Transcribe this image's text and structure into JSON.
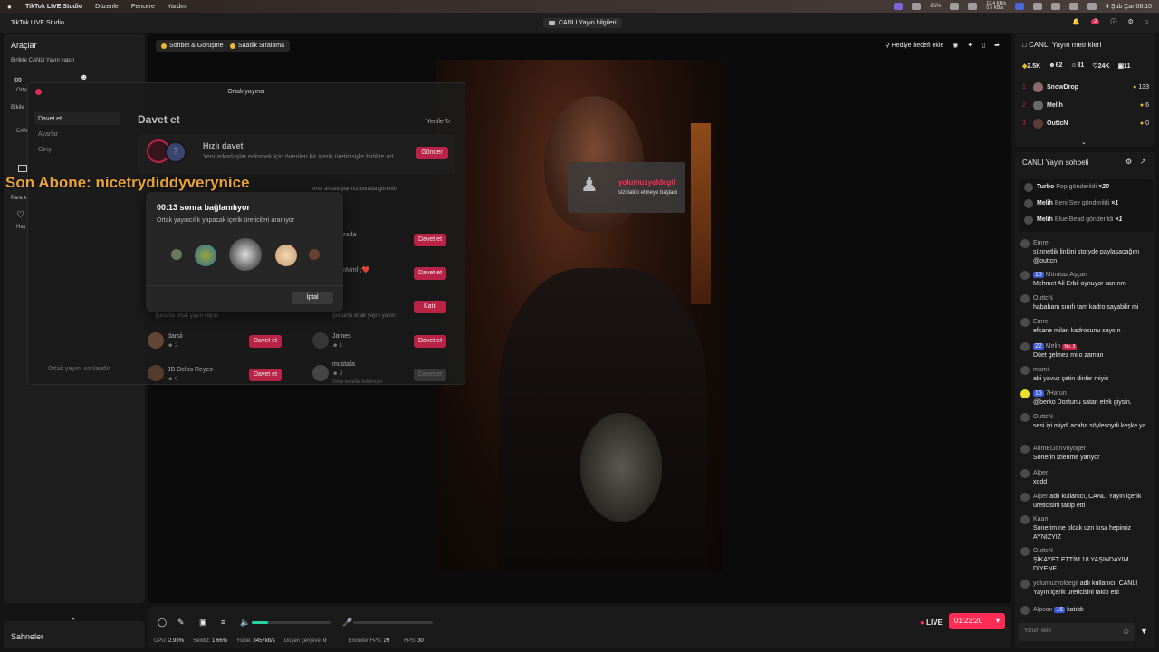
{
  "menubar": {
    "app": "TikTok LIVE Studio",
    "items": [
      "Düzenle",
      "Pencere",
      "Yardım"
    ],
    "datetime": "4 Şub Çar  06:10",
    "battery": "86%",
    "net_up": "12.4 KB/s",
    "net_down": "0.6 KB/s"
  },
  "titlebar": {
    "title": "TikTok LIVE Studio",
    "center": "CANLI Yayın bilgileri",
    "badge": "2"
  },
  "left": {
    "title": "Araçlar",
    "section1": "Birlikte CANLI Yayın yapın",
    "tool1": "Orta",
    "section2": "Etkile",
    "tool2": "CAN",
    "section3": "Para k",
    "tool3": "Hay",
    "scenes": "Sahneler"
  },
  "center": {
    "pill1": "Sohbet & Görüşme",
    "pill2": "Saatlik Sıralama",
    "gift_goal": "Hediye hedefi ekle"
  },
  "follow_popup": {
    "user": "yolumuzyoldegil",
    "text": "sizi takip etmeye başladı"
  },
  "overlay_text": "Son Abone: nicetrydiddyverynice",
  "modal": {
    "title": "Ortak yayıncı",
    "nav": [
      "Davet et",
      "Ayarlar",
      "Giriş"
    ],
    "heading": "Davet et",
    "refresh": "Yenile",
    "quick_title": "Hızlı davet",
    "quick_desc": "Yeni arkadaşlar edinmek için önerilen bir içerik üreticisiyle birlikte ort...",
    "send_btn": "Gönder",
    "info_text": "rımcı arkadaşlarınız burada görünür",
    "rows": [
      {
        "name": "nie Quizada",
        "btn": "Davet et"
      },
      {
        "name": "ile KimMml);❤️",
        "btn": "Davet et"
      },
      {
        "name": "e",
        "btn": "Katıl"
      }
    ],
    "row3_sub": "Şununla ortak yayın yapın:",
    "row3_sub2": "Şununla ortak yayın yapın:",
    "grid": [
      {
        "name": "darsii",
        "count": "2",
        "btn": "Davet et"
      },
      {
        "name": "James",
        "count": "1",
        "btn": "Davet et"
      },
      {
        "name": "JB Delos Reyes",
        "count": "0",
        "btn": "Davet et"
      },
      {
        "name": "mustafa",
        "count": "2",
        "btn": "Davet et",
        "sub": "Ortak kanallar bekleniyor"
      }
    ],
    "bottom_left": "Ortak yayını sonlandır"
  },
  "connecting": {
    "title": "00:13 sonra bağlanılıyor",
    "subtitle": "Ortak yayıncılık yapacak içerik üreticileri aranıyor",
    "cancel": "İptal"
  },
  "metrics": {
    "title": "CANLI Yayın metrikleri",
    "stats": [
      "2.5K",
      "62",
      "31",
      "24K",
      "11"
    ],
    "rank": [
      {
        "name": "SnowDrop",
        "value": "133"
      },
      {
        "name": "Melih",
        "value": "6"
      },
      {
        "name": "OuttcN",
        "value": "0"
      }
    ]
  },
  "chat": {
    "title": "CANLI Yayın sohbeti",
    "gifts": [
      {
        "user": "Turbo",
        "text": "Pop gönderildi",
        "mult": "×20"
      },
      {
        "user": "Melih",
        "text": "Beni Sev gönderildi",
        "mult": "×1"
      },
      {
        "user": "Melih",
        "text": "Blue Bead gönderildi",
        "mult": "×1"
      }
    ],
    "messages": [
      {
        "user": "Emre",
        "text": "sünnetlik linkini storyde paylaşacağım @outtcn"
      },
      {
        "user": "Mümtaz Aşçan",
        "badge": "10",
        "text": "Mehmet Ali Erbil oynuyor sanırım"
      },
      {
        "user": "OuttcN",
        "text": "hababam sınıfı tam kadro sayabilir mi"
      },
      {
        "user": "Emre",
        "text": "efsane milan kadrosunu saysın"
      },
      {
        "user": "Melih",
        "badge": "22",
        "rank": "No. 3",
        "text": "Düet gelmez mi o zaman"
      },
      {
        "user": "mami",
        "text": "abi yavuz çetin dinler miyiz"
      },
      {
        "user": "7Harun",
        "badge": "16",
        "text": "@berko Dostunu satan etek giysin."
      },
      {
        "user": "OuttcN",
        "text": "sesi iyi miydi acaba söylesoydi keşke ya"
      },
      {
        "user": "AhmEtJönVoyoger",
        "text": "Sonerin izlenme yarıyor"
      },
      {
        "user": "Alper",
        "text": "xddd"
      },
      {
        "user": "Alper",
        "text": "adlı kullanıcı, CANLI Yayın içerik üreticisini takip etti"
      },
      {
        "user": "Kaan",
        "text": "Sonerim ne olcak uzn kısa hepimiz AYNIZYIZ"
      },
      {
        "user": "OuttcN",
        "text": "ŞİKAYET ETTİM 18 YAŞINDAYIM DİYENE"
      },
      {
        "user": "yolumuzyoldegil",
        "text": "adlı kullanıcı, CANLI Yayın içerik üreticisini takip etti"
      },
      {
        "user": "Alpcan",
        "badge": "16",
        "text": "katıldı"
      }
    ],
    "input_placeholder": "Yorum ekle"
  },
  "bottom": {
    "live": "LIVE",
    "timer": "01:23:20",
    "stats": [
      {
        "label": "CPU:",
        "value": "2.93%"
      },
      {
        "label": "Selidiz:",
        "value": "1.66%"
      },
      {
        "label": "Yükle:",
        "value": "3457kb/s"
      },
      {
        "label": "Düşen çerçeve:",
        "value": "0"
      },
      {
        "label": "Encoder FPS:",
        "value": "29"
      },
      {
        "label": "FPS:",
        "value": "30"
      }
    ],
    "volume_level": 0.2
  },
  "colors": {
    "accent": "#e8315a",
    "live_btn": "#fe2c55",
    "gold": "#e9b830",
    "overlay": "#e8a33a",
    "volume": "#27d3a2"
  }
}
